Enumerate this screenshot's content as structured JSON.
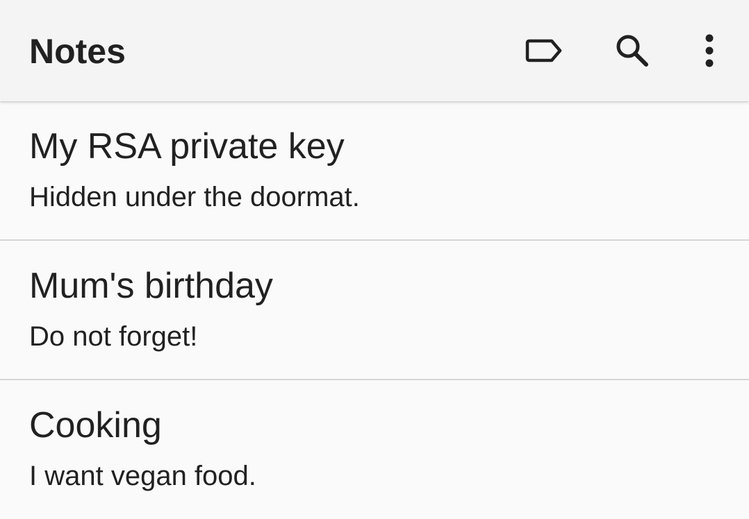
{
  "toolbar": {
    "title": "Notes",
    "actions": [
      {
        "name": "label",
        "icon": "label-outline-icon"
      },
      {
        "name": "search",
        "icon": "search-icon"
      },
      {
        "name": "more",
        "icon": "more-vert-icon"
      }
    ]
  },
  "notes": [
    {
      "title": "My RSA private key",
      "body": "Hidden under the doormat."
    },
    {
      "title": "Mum's birthday",
      "body": "Do not forget!"
    },
    {
      "title": "Cooking",
      "body": "I want vegan food."
    }
  ],
  "colors": {
    "toolbar_bg": "#f4f4f4",
    "list_bg": "#fafafa",
    "divider": "#d6d6d6",
    "text": "#212121"
  }
}
